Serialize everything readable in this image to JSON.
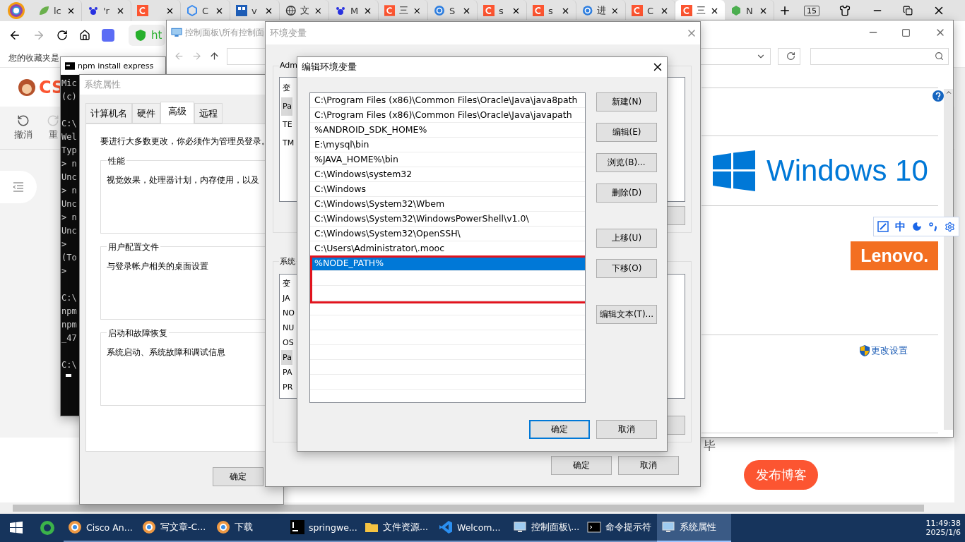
{
  "browser": {
    "tabs": [
      {
        "kind": "leaf",
        "label": "lc",
        "selected": false
      },
      {
        "kind": "paw",
        "label": "'r",
        "selected": false
      },
      {
        "kind": "csdn",
        "selected": false
      },
      {
        "kind": "cube",
        "label": "C",
        "selected": false
      },
      {
        "kind": "tile",
        "label": "v",
        "selected": false
      },
      {
        "kind": "globe",
        "label": "文",
        "selected": false
      },
      {
        "kind": "paw",
        "label": "M",
        "selected": false
      },
      {
        "kind": "csdn",
        "label": "三",
        "selected": false
      },
      {
        "kind": "ring",
        "label": "S",
        "selected": false
      },
      {
        "kind": "csdn",
        "label": "s",
        "selected": false
      },
      {
        "kind": "csdn",
        "label": "s",
        "selected": false
      },
      {
        "kind": "ring",
        "label": "进",
        "selected": false
      },
      {
        "kind": "csdn",
        "label": "C",
        "selected": false
      },
      {
        "kind": "csdn",
        "label": "三",
        "selected": true
      },
      {
        "kind": "hex",
        "label": "N",
        "selected": false
      }
    ],
    "tab_counter": "15",
    "address": "ht",
    "bookmark_notice": "您的收藏夹是"
  },
  "editor_page": {
    "logo": "CS",
    "tools": [
      {
        "label": "撤消"
      },
      {
        "label": "重"
      }
    ],
    "status_text": "毕",
    "publish_button": "发布博客"
  },
  "cmd_window": {
    "title": "npm install express",
    "blocks": [
      [
        "Mic",
        "(c)"
      ],
      [
        "C:\\",
        "Wel",
        "Typ",
        "> n",
        "Unc",
        "> n",
        "Unc",
        "> n",
        "Unc",
        ">",
        "(To",
        ">"
      ],
      [
        "C:\\",
        "npm",
        "npm",
        "_47"
      ],
      [
        "C:\\"
      ]
    ]
  },
  "control_panel": {
    "title": "控制面板\\所有控制面",
    "brand_text": "Windows 10",
    "oem_text": "Lenovo.",
    "change_settings": "更改设置"
  },
  "system_properties": {
    "title": "系统属性",
    "tabs": [
      {
        "label": "计算机名",
        "selected": false
      },
      {
        "label": "硬件",
        "selected": false
      },
      {
        "label": "高级",
        "selected": true
      },
      {
        "label": "远程",
        "selected": false
      }
    ],
    "notice": "要进行大多数更改，你必须作为管理员登录。",
    "groups": [
      {
        "title": "性能",
        "text": "视觉效果，处理器计划，内存使用，以及"
      },
      {
        "title": "用户配置文件",
        "text": "与登录帐户相关的桌面设置"
      },
      {
        "title": "启动和故障恢复",
        "text": "系统启动、系统故障和调试信息"
      }
    ],
    "ok_button": "确定"
  },
  "env_window": {
    "title": "环境变量",
    "user_group": "Adm",
    "user_rows": [
      {
        "text": "变",
        "selected": false
      },
      {
        "text": "Pa",
        "selected": true
      },
      {
        "text": "TE",
        "selected": false
      },
      {
        "text": "TM",
        "selected": false
      }
    ],
    "system_group": "系统",
    "system_rows": [
      {
        "text": "变",
        "selected": false
      },
      {
        "text": "JA",
        "selected": false
      },
      {
        "text": "NO",
        "selected": false
      },
      {
        "text": "NU",
        "selected": false
      },
      {
        "text": "OS",
        "selected": false
      },
      {
        "text": "Pa",
        "selected": true
      },
      {
        "text": "PA",
        "selected": false
      },
      {
        "text": "PR",
        "selected": false
      }
    ],
    "ok_button": "确定",
    "cancel_button": "取消"
  },
  "edit_dialog": {
    "title": "编辑环境变量",
    "paths": [
      {
        "text": "C:\\Program Files (x86)\\Common Files\\Oracle\\Java\\java8path",
        "selected": false
      },
      {
        "text": "C:\\Program Files (x86)\\Common Files\\Oracle\\Java\\javapath",
        "selected": false
      },
      {
        "text": "%ANDROID_SDK_HOME%",
        "selected": false
      },
      {
        "text": "E:\\mysql\\bin",
        "selected": false
      },
      {
        "text": "%JAVA_HOME%\\bin",
        "selected": false
      },
      {
        "text": "C:\\Windows\\system32",
        "selected": false
      },
      {
        "text": "C:\\Windows",
        "selected": false
      },
      {
        "text": "C:\\Windows\\System32\\Wbem",
        "selected": false
      },
      {
        "text": "C:\\Windows\\System32\\WindowsPowerShell\\v1.0\\",
        "selected": false
      },
      {
        "text": "C:\\Windows\\System32\\OpenSSH\\",
        "selected": false
      },
      {
        "text": "C:\\Users\\Administrator\\.mooc",
        "selected": false
      },
      {
        "text": "%NODE_PATH%",
        "selected": true
      }
    ],
    "side_buttons": [
      {
        "label": "新建(N)"
      },
      {
        "label": "编辑(E)"
      },
      {
        "label": "浏览(B)..."
      },
      {
        "label": "删除(D)"
      },
      {
        "label": "上移(U)"
      },
      {
        "label": "下移(O)"
      },
      {
        "label": "编辑文本(T)..."
      }
    ],
    "ok_button": "确定",
    "cancel_button": "取消"
  },
  "ime_toolbar": {
    "mode": "中"
  },
  "taskbar": {
    "items": [
      {
        "kind": "ring",
        "label": "Cisco An...",
        "selected": false
      },
      {
        "kind": "ring",
        "label": "写文章-C...",
        "selected": false
      },
      {
        "kind": "ring",
        "label": "下载",
        "selected": false
      },
      {
        "kind": "ide",
        "label": "springwe...",
        "selected": false
      },
      {
        "kind": "folder",
        "label": "文件资源...",
        "selected": false
      },
      {
        "kind": "code",
        "label": "Welcom...",
        "selected": false
      },
      {
        "kind": "monitor",
        "label": "控制面板\\...",
        "selected": false
      },
      {
        "kind": "console",
        "label": "命令提示符",
        "selected": false
      },
      {
        "kind": "monitor",
        "label": "系统属性",
        "selected": true
      }
    ],
    "time": "11:49:38",
    "date": "2025/1/6"
  }
}
